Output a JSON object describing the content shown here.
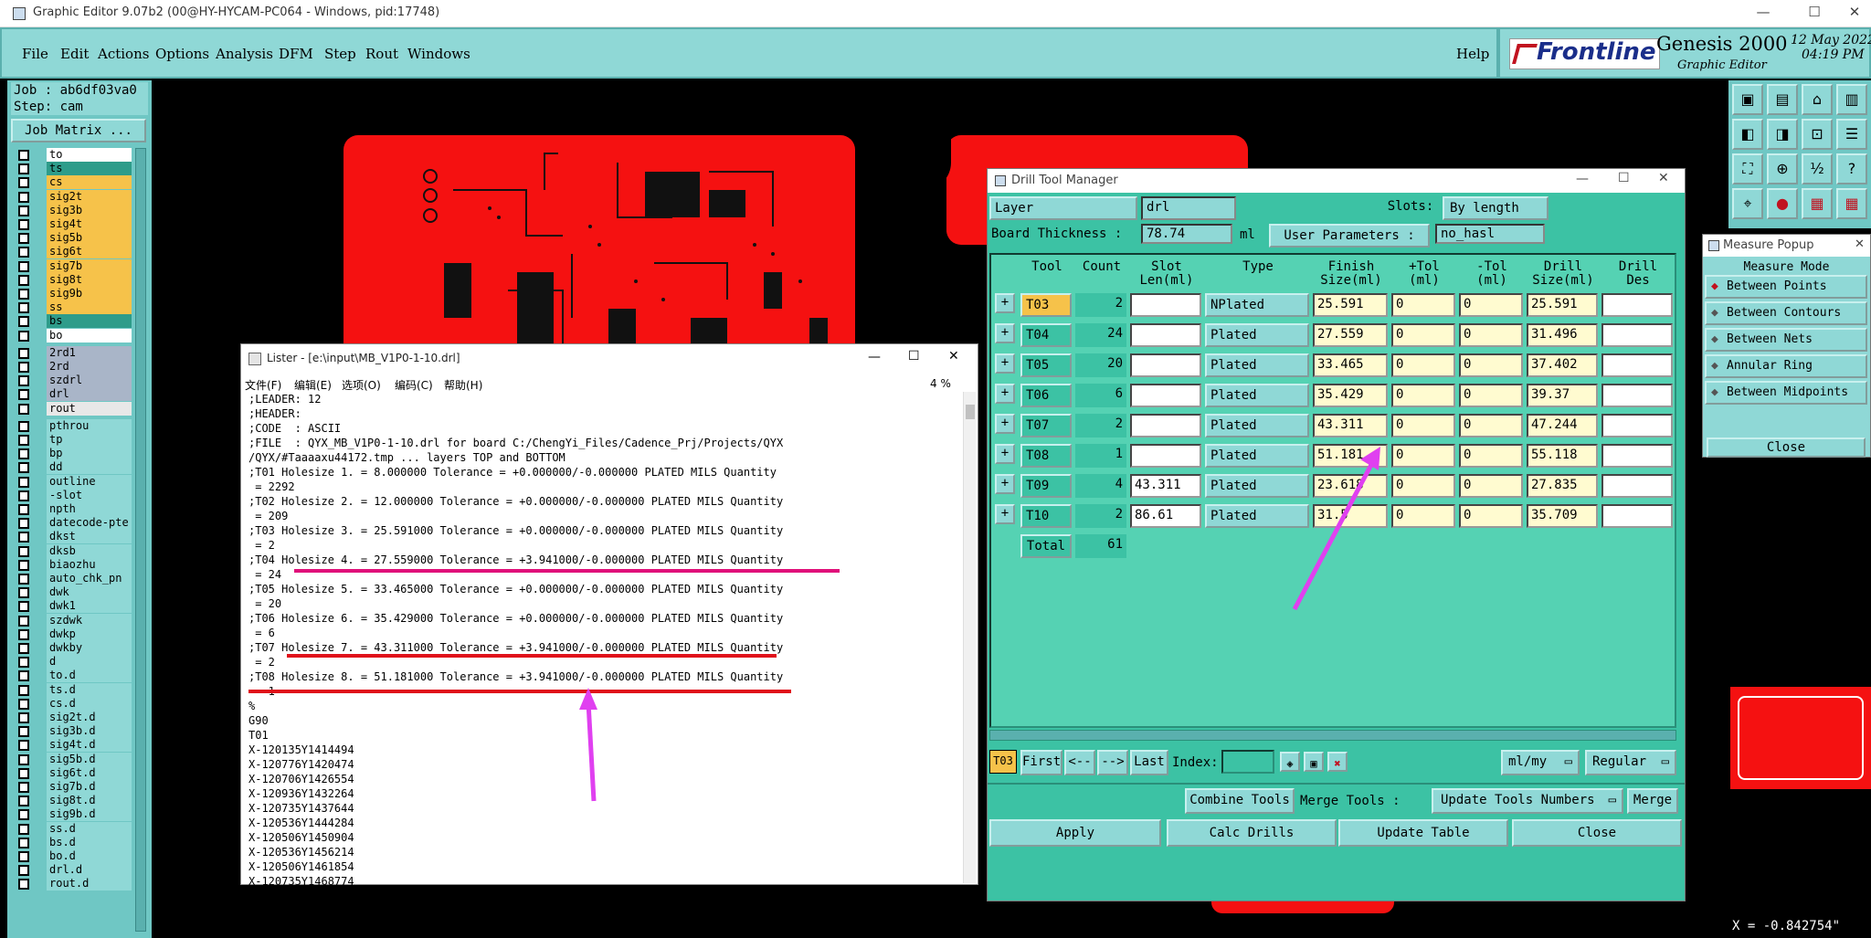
{
  "window": {
    "title": "Graphic Editor 9.07b2 (00@HY-HYCAM-PC064 - Windows, pid:17748)"
  },
  "menu": {
    "items": [
      "File",
      "Edit",
      "Actions",
      "Options",
      "Analysis",
      "DFM",
      "Step",
      "Rout",
      "Windows"
    ],
    "help": "Help"
  },
  "brand": {
    "logo": "Frontline",
    "product": "Genesis 2000",
    "subtitle": "Graphic Editor",
    "date": "12 May 2022",
    "time": "04:19 PM"
  },
  "job": {
    "job": "Job : ab6df03va0",
    "step": "Step: cam",
    "matrix_btn": "Job Matrix ..."
  },
  "layers": [
    {
      "name": "to",
      "color": "#ffffff"
    },
    {
      "name": "ts",
      "color": "#2e9c8a"
    },
    {
      "name": "cs",
      "color": "#f6c24a"
    },
    {
      "name": "sig2t",
      "color": "#f6c24a"
    },
    {
      "name": "sig3b",
      "color": "#f6c24a"
    },
    {
      "name": "sig4t",
      "color": "#f6c24a"
    },
    {
      "name": "sig5b",
      "color": "#f6c24a"
    },
    {
      "name": "sig6t",
      "color": "#f6c24a"
    },
    {
      "name": "sig7b",
      "color": "#f6c24a"
    },
    {
      "name": "sig8t",
      "color": "#f6c24a"
    },
    {
      "name": "sig9b",
      "color": "#f6c24a"
    },
    {
      "name": "ss",
      "color": "#f6c24a"
    },
    {
      "name": "bs",
      "color": "#2e9c8a"
    },
    {
      "name": "bo",
      "color": "#ffffff"
    },
    {
      "name": "2rd1",
      "color": "#a9b5c8"
    },
    {
      "name": "2rd",
      "color": "#a9b5c8"
    },
    {
      "name": "szdrl",
      "color": "#a9b5c8"
    },
    {
      "name": "drl",
      "color": "#a9b5c8"
    },
    {
      "name": "rout",
      "color": "#e8e8e8"
    },
    {
      "name": "pthrou",
      "color": "#8fd8d6"
    },
    {
      "name": "tp",
      "color": "#8fd8d6"
    },
    {
      "name": "bp",
      "color": "#8fd8d6"
    },
    {
      "name": "dd",
      "color": "#8fd8d6"
    },
    {
      "name": "outline",
      "color": "#8fd8d6"
    },
    {
      "name": "-slot",
      "color": "#8fd8d6"
    },
    {
      "name": "npth",
      "color": "#8fd8d6"
    },
    {
      "name": "datecode-pte",
      "color": "#8fd8d6"
    },
    {
      "name": "dkst",
      "color": "#8fd8d6"
    },
    {
      "name": "dksb",
      "color": "#8fd8d6"
    },
    {
      "name": "biaozhu",
      "color": "#8fd8d6"
    },
    {
      "name": "auto_chk_pn",
      "color": "#8fd8d6"
    },
    {
      "name": "dwk",
      "color": "#8fd8d6"
    },
    {
      "name": "dwk1",
      "color": "#8fd8d6"
    },
    {
      "name": "szdwk",
      "color": "#8fd8d6"
    },
    {
      "name": "dwkp",
      "color": "#8fd8d6"
    },
    {
      "name": "dwkby",
      "color": "#8fd8d6"
    },
    {
      "name": "d",
      "color": "#8fd8d6"
    },
    {
      "name": "to.d",
      "color": "#8fd8d6"
    },
    {
      "name": "ts.d",
      "color": "#8fd8d6"
    },
    {
      "name": "cs.d",
      "color": "#8fd8d6"
    },
    {
      "name": "sig2t.d",
      "color": "#8fd8d6"
    },
    {
      "name": "sig3b.d",
      "color": "#8fd8d6"
    },
    {
      "name": "sig4t.d",
      "color": "#8fd8d6"
    },
    {
      "name": "sig5b.d",
      "color": "#8fd8d6"
    },
    {
      "name": "sig6t.d",
      "color": "#8fd8d6"
    },
    {
      "name": "sig7b.d",
      "color": "#8fd8d6"
    },
    {
      "name": "sig8t.d",
      "color": "#8fd8d6"
    },
    {
      "name": "sig9b.d",
      "color": "#8fd8d6"
    },
    {
      "name": "ss.d",
      "color": "#8fd8d6"
    },
    {
      "name": "bs.d",
      "color": "#8fd8d6"
    },
    {
      "name": "bo.d",
      "color": "#8fd8d6"
    },
    {
      "name": "drl.d",
      "color": "#8fd8d6"
    },
    {
      "name": "rout.d",
      "color": "#8fd8d6"
    }
  ],
  "lister": {
    "title": "Lister - [e:\\input\\MB_V1P0-1-10.drl]",
    "menus": [
      "文件(F)",
      "编辑(E)",
      "选项(O)",
      "编码(C)",
      "帮助(H)"
    ],
    "percent": "4 %",
    "lines": [
      ";LEADER: 12",
      ";HEADER:",
      ";CODE  : ASCII",
      ";FILE  : QYX_MB_V1P0-1-10.drl for board C:/ChengYi_Files/Cadence_Prj/Projects/QYX",
      "/QYX/#Taaaaxu44172.tmp ... layers TOP and BOTTOM",
      ";T01 Holesize 1. = 8.000000 Tolerance = +0.000000/-0.000000 PLATED MILS Quantity",
      " = 2292",
      ";T02 Holesize 2. = 12.000000 Tolerance = +0.000000/-0.000000 PLATED MILS Quantity",
      " = 209",
      ";T03 Holesize 3. = 25.591000 Tolerance = +0.000000/-0.000000 PLATED MILS Quantity",
      " = 2",
      ";T04 Holesize 4. = 27.559000 Tolerance = +3.941000/-0.000000 PLATED MILS Quantity",
      " = 24",
      ";T05 Holesize 5. = 33.465000 Tolerance = +0.000000/-0.000000 PLATED MILS Quantity",
      " = 20",
      ";T06 Holesize 6. = 35.429000 Tolerance = +0.000000/-0.000000 PLATED MILS Quantity",
      " = 6",
      ";T07 Holesize 7. = 43.311000 Tolerance = +3.941000/-0.000000 PLATED MILS Quantity",
      " = 2",
      ";T08 Holesize 8. = 51.181000 Tolerance = +3.941000/-0.000000 PLATED MILS Quantity",
      " = 1",
      "%",
      "G90",
      "T01",
      "X-120135Y1414494",
      "X-120776Y1420474",
      "X-120706Y1426554",
      "X-120936Y1432264",
      "X-120735Y1437644",
      "X-120536Y1444284",
      "X-120506Y1450904",
      "X-120536Y1456214",
      "X-120506Y1461854",
      "X-120735Y1468774"
    ]
  },
  "dtm": {
    "title": "Drill Tool Manager",
    "layer_label": "Layer",
    "layer_value": "drl",
    "slots_label": "Slots:",
    "slots_value": "By length",
    "thickness_label": "Board Thickness :",
    "thickness_value": "78.74",
    "thickness_unit": "ml",
    "user_params_label": "User Parameters :",
    "user_params_value": "no_hasl",
    "headers": [
      "Tool",
      "Count",
      "Slot\nLen(ml)",
      "Type",
      "Finish\nSize(ml)",
      "+Tol\n(ml)",
      "-Tol\n(ml)",
      "Drill\nSize(ml)",
      "Drill\nDes"
    ],
    "rows": [
      {
        "tool": "T03",
        "count": "2",
        "slot": "",
        "type": "NPlated",
        "finish": "25.591",
        "ptol": "0",
        "mtol": "0",
        "drill": "25.591",
        "des": ""
      },
      {
        "tool": "T04",
        "count": "24",
        "slot": "",
        "type": "Plated",
        "finish": "27.559",
        "ptol": "0",
        "mtol": "0",
        "drill": "31.496",
        "des": ""
      },
      {
        "tool": "T05",
        "count": "20",
        "slot": "",
        "type": "Plated",
        "finish": "33.465",
        "ptol": "0",
        "mtol": "0",
        "drill": "37.402",
        "des": ""
      },
      {
        "tool": "T06",
        "count": "6",
        "slot": "",
        "type": "Plated",
        "finish": "35.429",
        "ptol": "0",
        "mtol": "0",
        "drill": "39.37",
        "des": ""
      },
      {
        "tool": "T07",
        "count": "2",
        "slot": "",
        "type": "Plated",
        "finish": "43.311",
        "ptol": "0",
        "mtol": "0",
        "drill": "47.244",
        "des": ""
      },
      {
        "tool": "T08",
        "count": "1",
        "slot": "",
        "type": "Plated",
        "finish": "51.181",
        "ptol": "0",
        "mtol": "0",
        "drill": "55.118",
        "des": ""
      },
      {
        "tool": "T09",
        "count": "4",
        "slot": "43.311",
        "type": "Plated",
        "finish": "23.618",
        "ptol": "0",
        "mtol": "0",
        "drill": "27.835",
        "des": ""
      },
      {
        "tool": "T10",
        "count": "2",
        "slot": "86.61",
        "type": "Plated",
        "finish": "31.5",
        "ptol": "0",
        "mtol": "0",
        "drill": "35.709",
        "des": ""
      }
    ],
    "total_label": "Total",
    "total_count": "61",
    "nav": {
      "current": "T03",
      "first": "First",
      "prev": "<--",
      "next": "-->",
      "last": "Last",
      "index": "Index:",
      "units": "ml/my",
      "mode": "Regular"
    },
    "tools": {
      "combine": "Combine Tools",
      "merge_label": "Merge Tools :",
      "update_numbers": "Update Tools Numbers",
      "merge": "Merge"
    },
    "actions": {
      "apply": "Apply",
      "calc": "Calc Drills",
      "update": "Update Table",
      "close": "Close"
    }
  },
  "measure": {
    "title": "Measure Popup",
    "mode": "Measure Mode",
    "options": [
      "Between Points",
      "Between Contours",
      "Between Nets",
      "Annular Ring",
      "Between Midpoints"
    ],
    "close": "Close"
  },
  "status": {
    "coord": "X = -0.842754\""
  }
}
